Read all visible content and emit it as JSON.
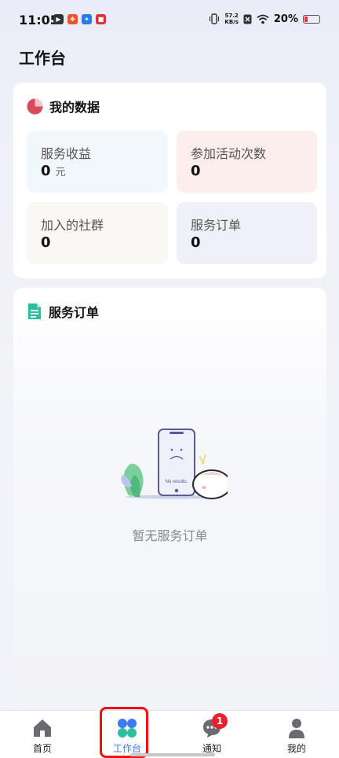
{
  "status_bar": {
    "time": "11:05",
    "net_speed_value": "57.2",
    "net_speed_unit": "KB/s",
    "battery_percent_label": "20%",
    "battery_level": 0.2,
    "app_icons": [
      "app-icon-1",
      "app-icon-2",
      "app-icon-3",
      "app-icon-4"
    ],
    "icons": [
      "vibrate-icon",
      "no-sim-icon",
      "wifi-icon",
      "battery-icon"
    ]
  },
  "page": {
    "title": "工作台"
  },
  "data_card": {
    "title": "我的数据",
    "icon": "pie-chart-icon",
    "tiles": [
      {
        "label": "服务收益",
        "value": "0",
        "unit": "元",
        "bg": "#f2f7fb"
      },
      {
        "label": "参加活动次数",
        "value": "0",
        "bg": "#fbeeec"
      },
      {
        "label": "加入的社群",
        "value": "0",
        "bg": "#f9f8f4"
      },
      {
        "label": "服务订单",
        "value": "0",
        "bg": "#f0f1f8"
      }
    ]
  },
  "orders_card": {
    "title": "服务订单",
    "icon": "document-icon",
    "empty_illustration_text": "No results.",
    "empty_text": "暂无服务订单"
  },
  "bottom_nav": {
    "items": [
      {
        "label": "首页",
        "icon": "home-icon"
      },
      {
        "label": "工作台",
        "icon": "workbench-icon",
        "active": true
      },
      {
        "label": "通知",
        "icon": "chat-bubble-icon",
        "badge": "1"
      },
      {
        "label": "我的",
        "icon": "person-icon"
      }
    ]
  },
  "colors": {
    "accent_blue": "#3b7cf6",
    "accent_teal": "#2bbf9f",
    "badge_red": "#e8222a",
    "highlight_outline": "#e11111"
  }
}
